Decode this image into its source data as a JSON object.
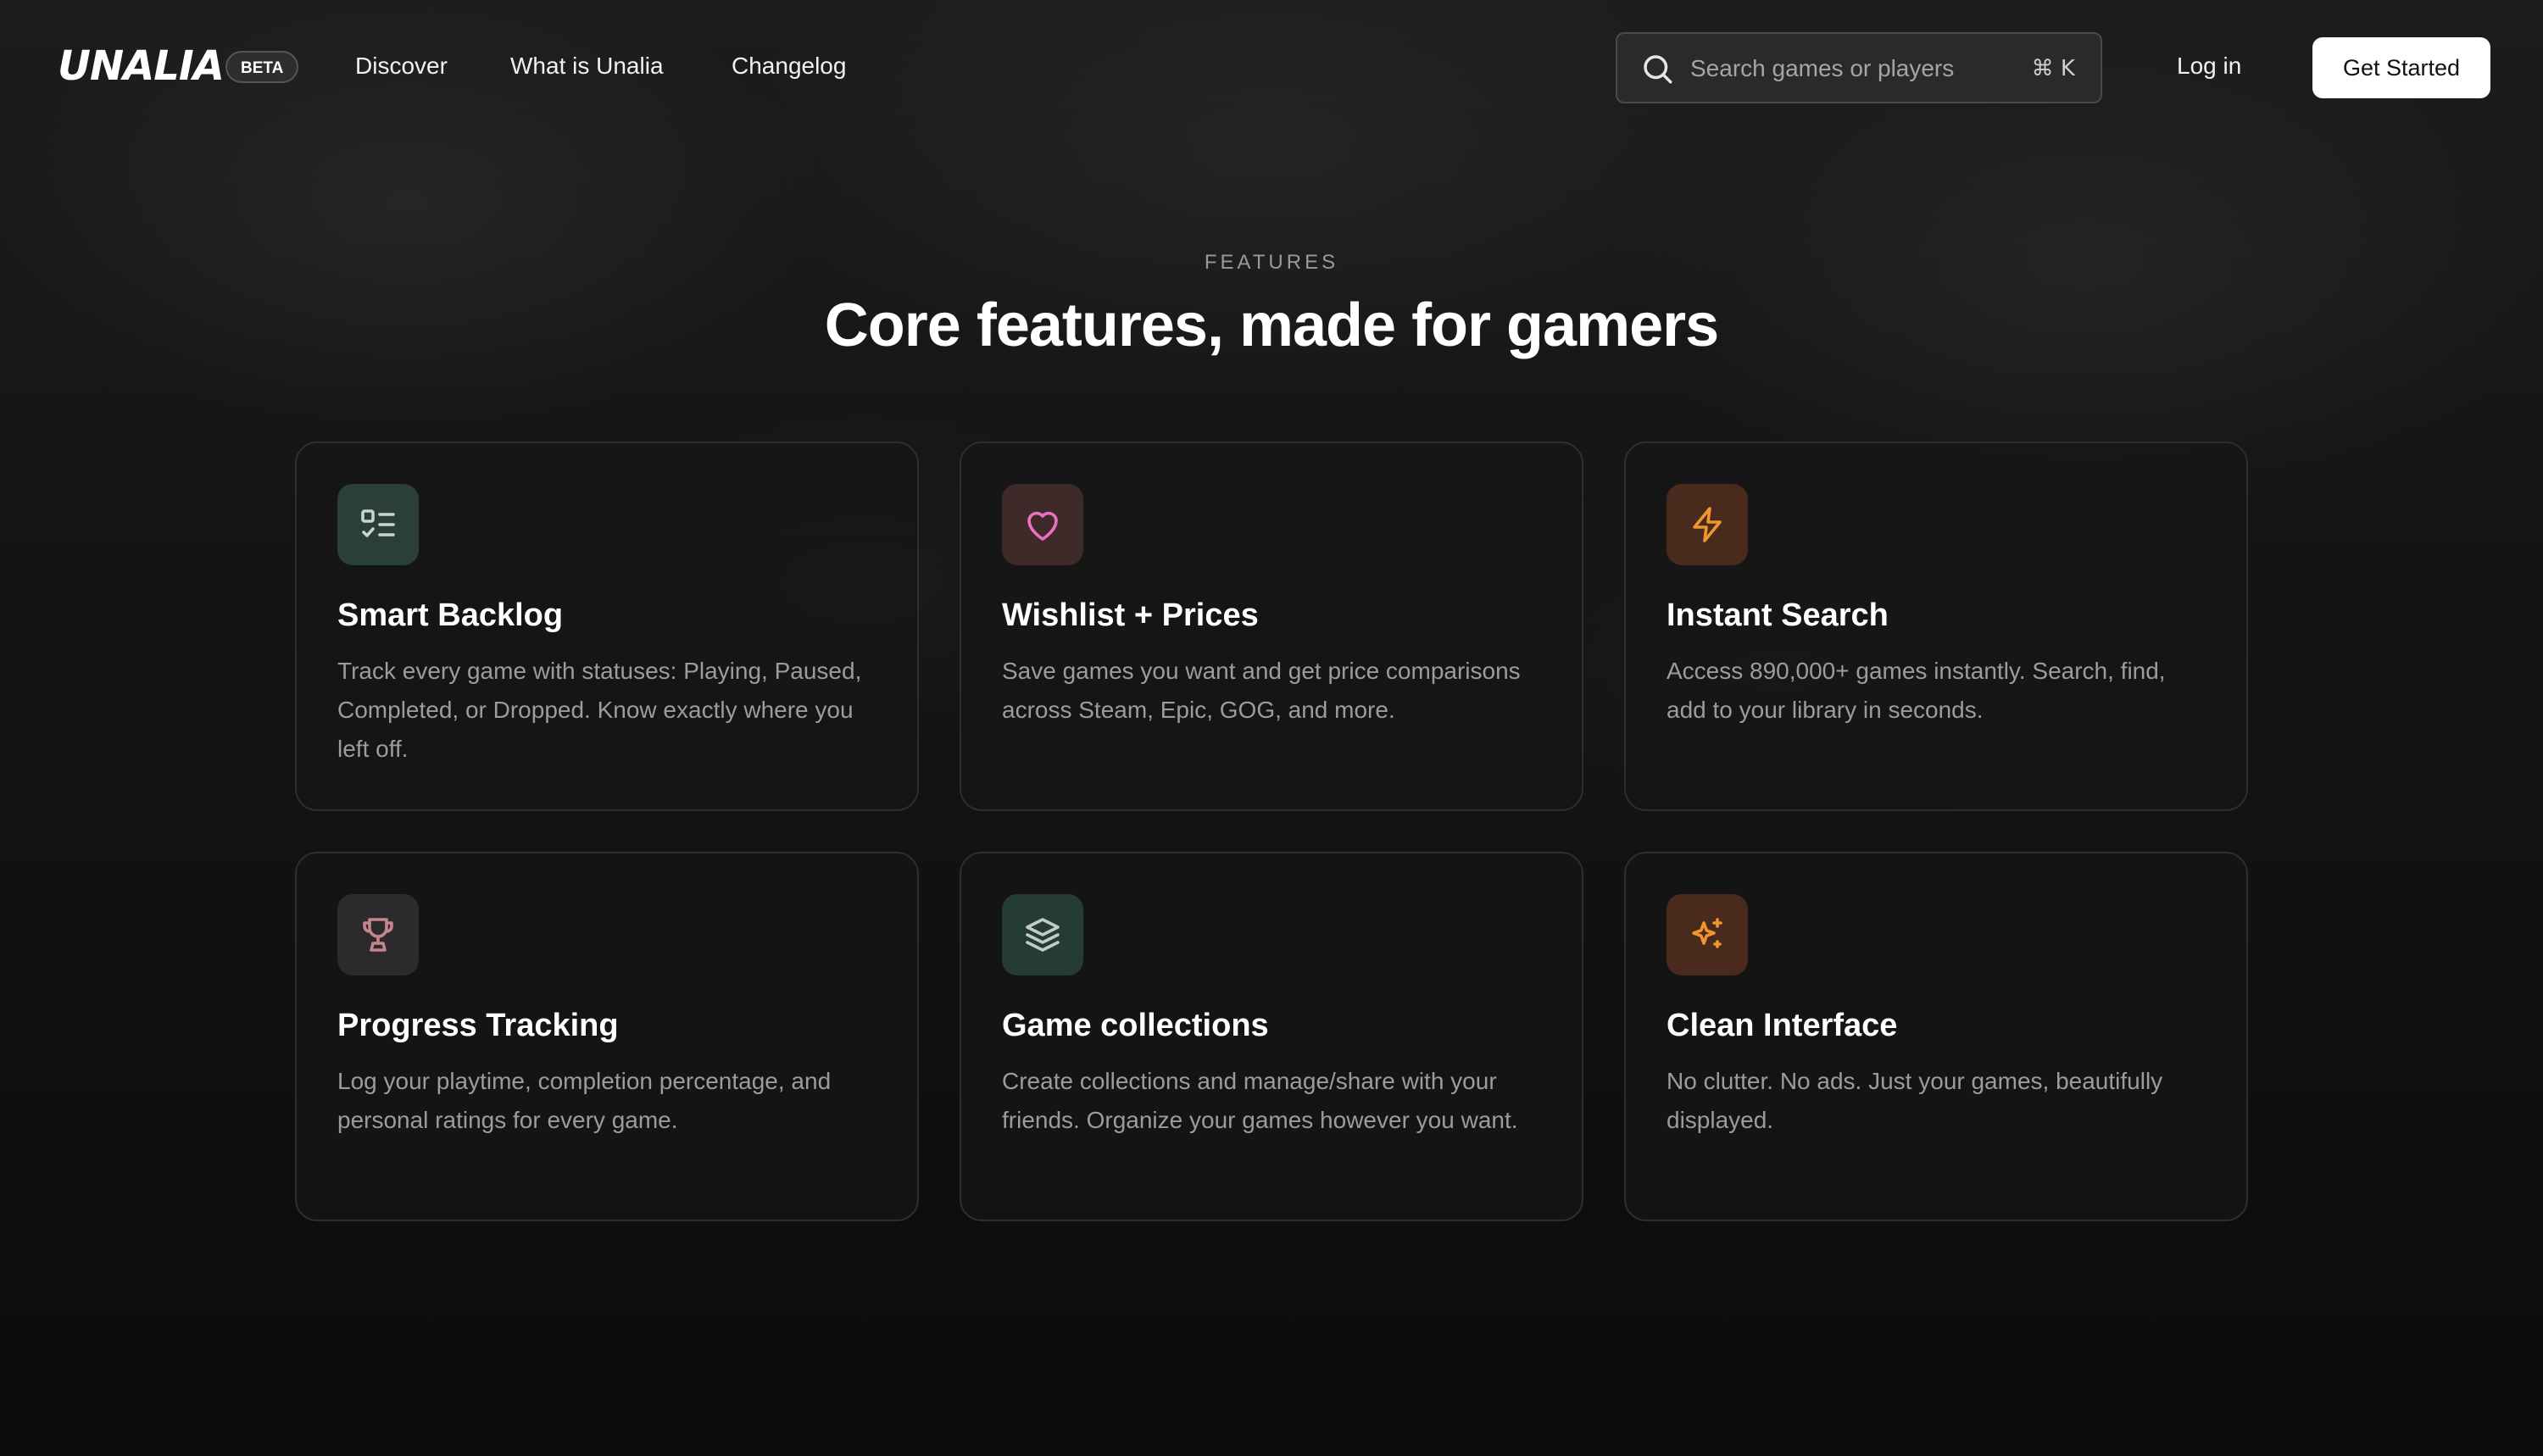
{
  "nav": {
    "logo": "UNALIA",
    "badge": "BETA",
    "links": [
      "Discover",
      "What is Unalia",
      "Changelog"
    ],
    "search": {
      "placeholder": "Search games or players",
      "shortcut": "⌘ K",
      "icon": "search-icon"
    },
    "login": "Log in",
    "cta": "Get Started"
  },
  "hero": {
    "eyebrow": "FEATURES",
    "title": "Core features, made for gamers"
  },
  "features": [
    {
      "title": "Smart Backlog",
      "description": "Track every game with statuses: Playing, Paused, Completed, or Dropped. Know exactly where you left off.",
      "icon": "checklist-icon",
      "icon_color": "#c9d3cf",
      "icon_bg": "#2a3f3a"
    },
    {
      "title": "Wishlist + Prices",
      "description": "Save games you want and get price comparisons across Steam, Epic, GOG, and more.",
      "icon": "heart-icon",
      "icon_color": "#ec6fc4",
      "icon_bg": "#3f2a2a"
    },
    {
      "title": "Instant Search",
      "description": "Access 890,000+ games instantly. Search, find, add to your library in seconds.",
      "icon": "lightning-icon",
      "icon_color": "#f0962f",
      "icon_bg": "#4a2a1c"
    },
    {
      "title": "Progress Tracking",
      "description": "Log your playtime, completion percentage, and personal ratings for every game.",
      "icon": "trophy-icon",
      "icon_color": "#c4868e",
      "icon_bg": "#2c2a2d"
    },
    {
      "title": "Game collections",
      "description": "Create collections and manage/share with your friends. Organize your games however you want.",
      "icon": "layers-icon",
      "icon_color": "#c3cbc8",
      "icon_bg": "#243b36"
    },
    {
      "title": "Clean Interface",
      "description": "No clutter. No ads. Just your games, beautifully displayed.",
      "icon": "sparkles-icon",
      "icon_color": "#f0962f",
      "icon_bg": "#4a2a1c"
    }
  ]
}
